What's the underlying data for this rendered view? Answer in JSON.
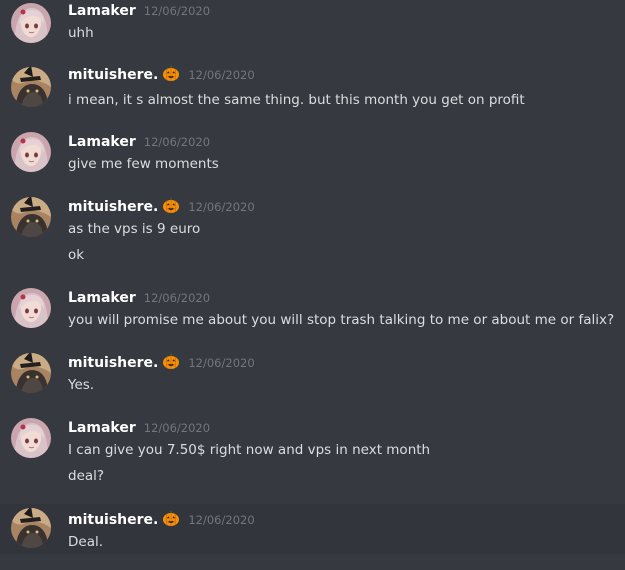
{
  "messages": [
    {
      "username": "Lamaker",
      "avatar": "anime-girl-avatar",
      "timestamp": "12/06/2020",
      "lines": [
        "uhh"
      ]
    },
    {
      "username": "mituishere.",
      "avatar": "cat-witch-hat-avatar",
      "badge": "pumpkin-icon",
      "timestamp": "12/06/2020",
      "lines": [
        "i mean, it s almost the same thing. but this month you get on profit"
      ]
    },
    {
      "username": "Lamaker",
      "avatar": "anime-girl-avatar",
      "timestamp": "12/06/2020",
      "lines": [
        "give me few moments"
      ]
    },
    {
      "username": "mituishere.",
      "avatar": "cat-witch-hat-avatar",
      "badge": "pumpkin-icon",
      "timestamp": "12/06/2020",
      "lines": [
        "as the vps is 9 euro",
        "ok"
      ]
    },
    {
      "username": "Lamaker",
      "avatar": "anime-girl-avatar",
      "timestamp": "12/06/2020",
      "lines": [
        "you will promise me about you will stop trash talking to me or about me or falix?"
      ]
    },
    {
      "username": "mituishere.",
      "avatar": "cat-witch-hat-avatar",
      "badge": "pumpkin-icon",
      "timestamp": "12/06/2020",
      "lines": [
        "Yes."
      ]
    },
    {
      "username": "Lamaker",
      "avatar": "anime-girl-avatar",
      "timestamp": "12/06/2020",
      "lines": [
        "I can give you 7.50$ right now and vps in next month",
        "deal?"
      ]
    },
    {
      "username": "mituishere.",
      "avatar": "cat-witch-hat-avatar",
      "badge": "pumpkin-icon",
      "timestamp": "12/06/2020",
      "lines": [
        "Deal."
      ]
    }
  ],
  "colors": {
    "background": "#36393f",
    "hover_background": "#32353b",
    "username": "#ffffff",
    "timestamp": "#72767d",
    "text": "#dcddde"
  }
}
